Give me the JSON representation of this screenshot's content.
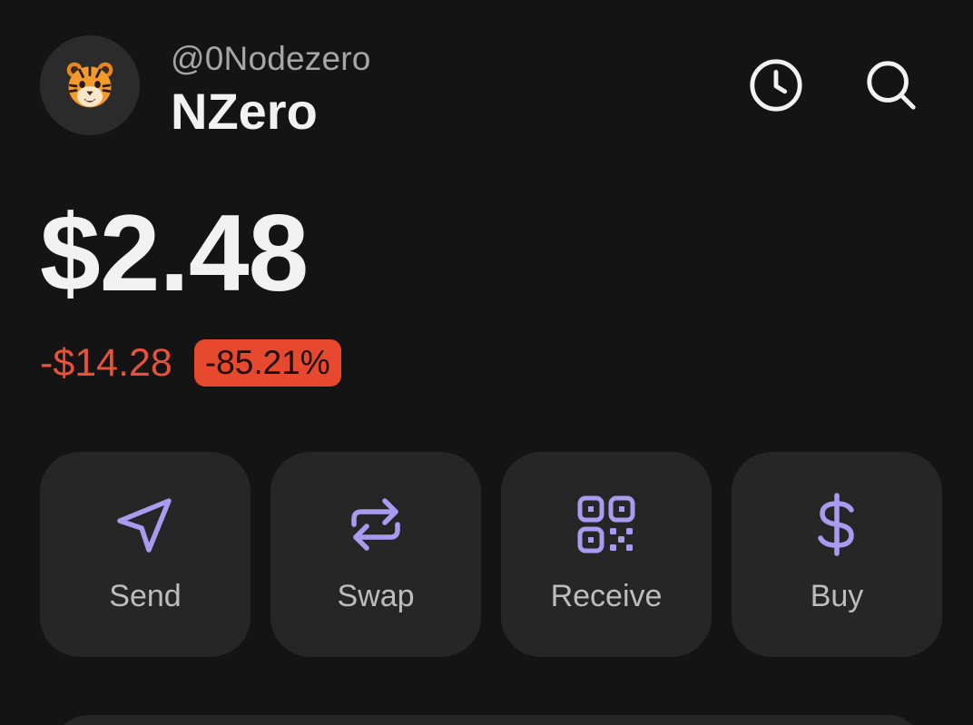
{
  "header": {
    "handle": "@0Nodezero",
    "account_name": "NZero",
    "avatar_icon": "tiger-emoji",
    "history_icon": "clock-icon",
    "search_icon": "search-icon"
  },
  "balance": {
    "amount": "$2.48",
    "change_amount": "-$14.28",
    "change_percent": "-85.21%",
    "negative_color": "#e8523a"
  },
  "actions": [
    {
      "label": "Send",
      "icon": "send-icon"
    },
    {
      "label": "Swap",
      "icon": "swap-icon"
    },
    {
      "label": "Receive",
      "icon": "qr-code-icon"
    },
    {
      "label": "Buy",
      "icon": "dollar-icon"
    }
  ],
  "colors": {
    "accent": "#a99bf0",
    "background": "#141414",
    "card": "#262626"
  }
}
